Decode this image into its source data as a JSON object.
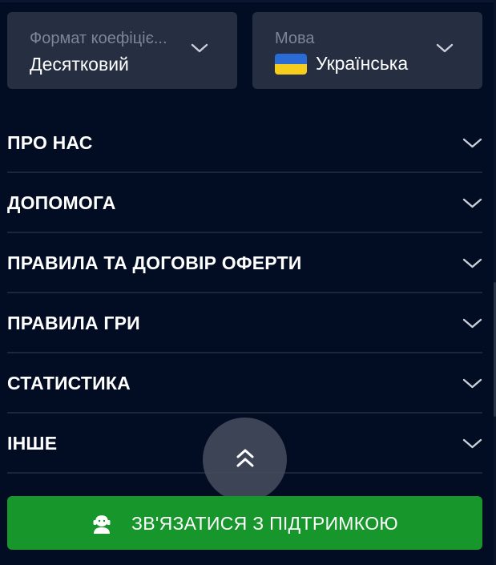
{
  "settings": {
    "odds_format": {
      "label": "Формат коефіціє...",
      "value": "Десятковий",
      "icon": "chevron-down-icon"
    },
    "language": {
      "label": "Мова",
      "value": "Українська",
      "flag_icon": "ukraine-flag-icon",
      "icon": "chevron-down-icon"
    }
  },
  "accordion": {
    "items": [
      {
        "label": "ПРО НАС"
      },
      {
        "label": "ДОПОМОГА"
      },
      {
        "label": "ПРАВИЛА ТА ДОГОВІР ОФЕРТИ"
      },
      {
        "label": "ПРАВИЛА ГРИ"
      },
      {
        "label": "СТАТИСТИКА"
      },
      {
        "label": "ІНШЕ"
      }
    ]
  },
  "scroll_top": {
    "icon": "double-chevron-up-icon"
  },
  "support": {
    "label": "ЗВ'ЯЗАТИСЯ З ПІДТРИМКОЮ",
    "icon": "support-agent-icon"
  },
  "colors": {
    "background": "#020d23",
    "panel": "#262f42",
    "divider": "#1d2638",
    "muted_text": "#7d8699",
    "support_green": "#16962b"
  }
}
